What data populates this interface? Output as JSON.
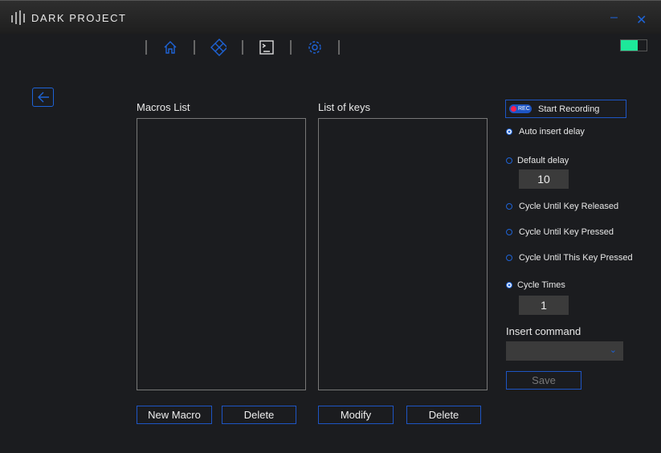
{
  "app": {
    "title": "DARK PROJECT",
    "minimize": "–",
    "close": "✕"
  },
  "nav": {
    "items": [
      "home-icon",
      "keyboard-icon",
      "macro-icon",
      "settings-icon"
    ],
    "active": "macro-icon"
  },
  "battery": {
    "level": 0.65,
    "color": "#1de89a"
  },
  "macros": {
    "title": "Macros List",
    "new_label": "New Macro",
    "delete_label": "Delete",
    "items": []
  },
  "keys": {
    "title": "List of keys",
    "modify_label": "Modify",
    "delete_label": "Delete",
    "items": []
  },
  "panel": {
    "rec_badge": "REC",
    "record_label": "Start Recording",
    "auto_insert": "Auto insert delay",
    "default_delay": "Default delay",
    "default_delay_value": "10",
    "cycle_released": "Cycle Until Key Released",
    "cycle_pressed": "Cycle Until Key Pressed",
    "cycle_this": "Cycle Until This Key Pressed",
    "cycle_times": "Cycle Times",
    "cycle_times_value": "1",
    "insert_command": "Insert command",
    "insert_value": "",
    "save_label": "Save"
  },
  "colors": {
    "accent": "#1e63d6",
    "background": "#1b1c1f"
  }
}
